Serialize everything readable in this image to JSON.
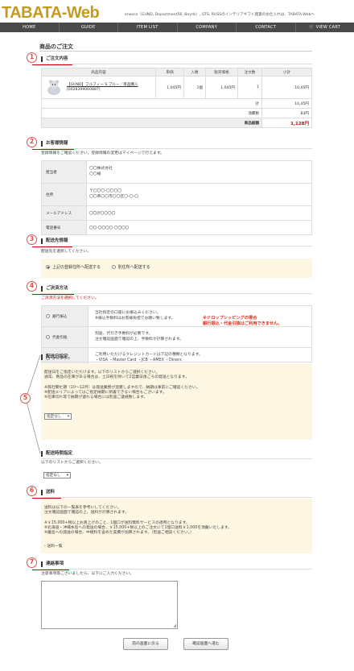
{
  "header": {
    "logo": "TABATA-Web",
    "tagline": "enesco（GUND, Department56, Boyds）, GTS, RUSSのインテリアギフト雑貨のお仕入れは、TABATA-Webへ"
  },
  "nav": [
    "HOME",
    "GUIDE",
    "ITEM LIST",
    "COMPANY",
    "CONTACT",
    "VIEW CART"
  ],
  "page_title": "商品のご注文",
  "markers": [
    "1",
    "2",
    "3",
    "4",
    "5",
    "6",
    "7"
  ],
  "order": {
    "heading": "ご注文内容",
    "columns": [
      "商品内容",
      "単価",
      "入数",
      "販売価格",
      "注文数",
      "小計"
    ],
    "item": {
      "name": "【GUND】フルフィー S ブルー／単品購入",
      "code": "[0028399060887]",
      "unit_price": "1,045円",
      "pack": "1個",
      "sale_price": "1,045円",
      "qty": "1",
      "subtotal": "10,45円"
    },
    "totals": [
      {
        "label": "計",
        "value": "10,45円"
      },
      {
        "label": "消費税",
        "value": "83円"
      },
      {
        "label": "商品総額",
        "value": "1,128円"
      }
    ]
  },
  "customer": {
    "heading": "お客様情報",
    "intro": "登録情報をご確認ください。登録情報の変更はマイページで行えます。",
    "rows": [
      {
        "label": "担当者",
        "value": "〇〇株式会社\n〇〇様"
      },
      {
        "label": "住所",
        "value": "〒〇〇〇-〇〇〇〇\n〇〇県〇〇市〇〇区〇-〇-〇"
      },
      {
        "label": "メールアドレス",
        "value": "〇〇＠〇〇〇〇"
      },
      {
        "label": "電話番号",
        "value": "〇〇-〇〇〇〇-〇〇〇〇"
      }
    ]
  },
  "shipping": {
    "heading": "配送先情報",
    "intro": "配送先を選択してください。",
    "options": [
      "上記の登録住所へ配送する",
      "別住所へ配送する"
    ]
  },
  "payment": {
    "heading": "ご決済方法",
    "intro": "ご決済方法を選択してください。",
    "methods": [
      {
        "label": "銀行振込",
        "desc": "当社指定の口座にお振込みください。\n※振込手数料はお客様負担でお願い致します。"
      },
      {
        "label": "代金引換",
        "desc": "別途、代引き手数料が必要です。\n注文確認画面で確認の上、手数料が計算されます。"
      },
      {
        "label": "クレジット",
        "desc": "ご利用いただけるクレジットカードは下記の種類となります。\n・VISA ・Master Card ・JCB ・AMEX ・Diners"
      }
    ],
    "dropship_note": "※ドロップシッピングの場合\n銀行振込・代金引換はご利用できません。"
  },
  "delivery_date": {
    "heading": "配送日指定",
    "text": "配送日をご指定いただけます。以下のリストからご選択ください。\n通常、商品の在庫がある場合は、土日祝を除いて2営業日後ごろの発送となります。\n\n※弊社繁忙期（10～12月）は発送業務が混雑しますので、納期は事前にご確認ください。\n※配送エリアによってはご指定納期に到着できない場合もございます。\n※在庫切れ等で納期が遅れる場合には別途ご連絡致します。",
    "select": "指定なし"
  },
  "delivery_time": {
    "heading": "配送時間指定",
    "text": "以下のリストからご選択ください。",
    "select": "指定なし"
  },
  "shipping_fee": {
    "heading": "送料",
    "text": "送料は以下の一覧表を参考にしてください。\n注文確認画面で確認の上、送料が計算されます。\n\n※￥15,000+税以上お買上げのこと、1個口が送料無料サービスの適用となります。\n※北海道・沖縄本島への発送の場合、￥15,000+税以上のご注文にて1個口送料￥1,000を頂戴いたします。\n※離島への発送の場合、中継料を含めた実費が加算されます。（別途ご相談ください。）",
    "link": "送料一覧"
  },
  "contact": {
    "heading": "連絡事項",
    "text": "注意事項等ございましたら、以下にご入力ください。"
  },
  "buttons": {
    "back": "前の画面に戻る",
    "confirm": "確認画面へ進む"
  },
  "colors": {
    "accent": "#d9534f",
    "gold": "#c49a22",
    "nav": "#4a4a4a"
  }
}
